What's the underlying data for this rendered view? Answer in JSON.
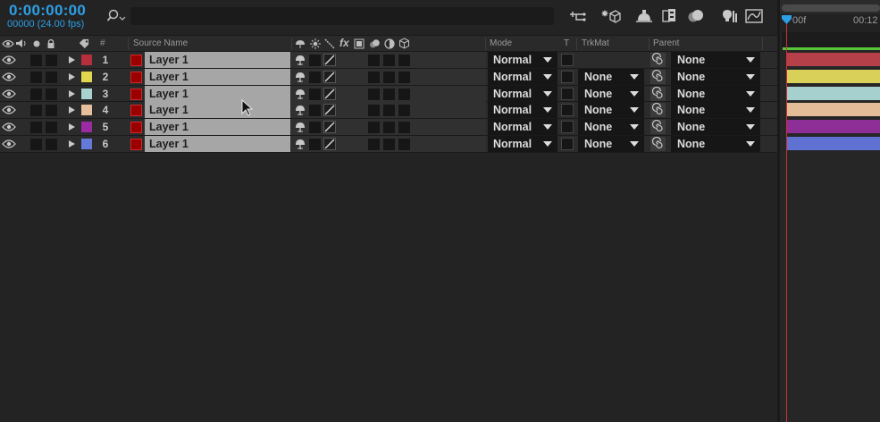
{
  "composition": {
    "timecode": "0:00:00:00",
    "frames": "00000 (24.00 fps)"
  },
  "columns": {
    "num": "#",
    "source_name": "Source Name",
    "mode": "Mode",
    "t": "T",
    "trkmat": "TrkMat",
    "parent": "Parent"
  },
  "layers": [
    {
      "num": "1",
      "label_color": "#b52f3c",
      "name": "Layer 1",
      "mode": "Normal",
      "trkmat": "",
      "parent": "None",
      "bar_color": "#b5404a"
    },
    {
      "num": "2",
      "label_color": "#e2d850",
      "name": "Layer 1",
      "mode": "Normal",
      "trkmat": "None",
      "parent": "None",
      "bar_color": "#d8d058"
    },
    {
      "num": "3",
      "label_color": "#a8d3d1",
      "name": "Layer 1",
      "mode": "Normal",
      "trkmat": "None",
      "parent": "None",
      "bar_color": "#a5d0ce"
    },
    {
      "num": "4",
      "label_color": "#e6c09c",
      "name": "Layer 1",
      "mode": "Normal",
      "trkmat": "None",
      "parent": "None",
      "bar_color": "#e3bc98"
    },
    {
      "num": "5",
      "label_color": "#9b2ba3",
      "name": "Layer 1",
      "mode": "Normal",
      "trkmat": "None",
      "parent": "None",
      "bar_color": "#8e2f98"
    },
    {
      "num": "6",
      "label_color": "#6579d9",
      "name": "Layer 1",
      "mode": "Normal",
      "trkmat": "None",
      "parent": "None",
      "bar_color": "#5f72d4"
    }
  ],
  "timeline": {
    "start_label": "00f",
    "mid_label": "00:12"
  },
  "colors": {
    "accent": "#2d9fe6",
    "playhead": "#d43030",
    "work_area": "#58c83b"
  }
}
